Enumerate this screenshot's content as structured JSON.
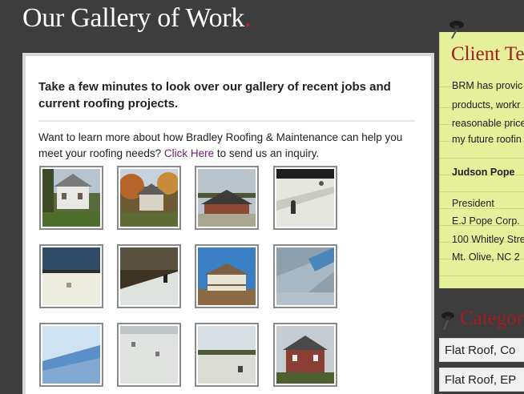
{
  "header": {
    "title": "Our Gallery of Work",
    "title_dot": "."
  },
  "main": {
    "heading": "Take a few minutes to look over our gallery of recent jobs and current roofing projects.",
    "intro_before": "Want to learn more about how Bradley Roofing & Maintenance can help you meet your roofing needs?",
    "link_text": "Click Here",
    "intro_after": "to send us an inquiry."
  },
  "sidebar": {
    "testimonial": {
      "title": "Client Te",
      "lines": [
        "BRM has provic",
        "products, workr",
        "reasonable price",
        "my future roofin"
      ],
      "name": "Judson Pope",
      "role": "President",
      "company": "E.J Pope Corp.",
      "street": "100 Whitley Stre",
      "city": "Mt. Olive, NC 2"
    },
    "categories": {
      "title": "Categor",
      "items": [
        "Flat Roof, Co",
        "Flat Roof, EP"
      ]
    }
  },
  "colors": {
    "accent_red": "#a41e22",
    "title_dot": "#c0242c",
    "link": "#6a1e6e",
    "note": "#e6ef9a"
  }
}
